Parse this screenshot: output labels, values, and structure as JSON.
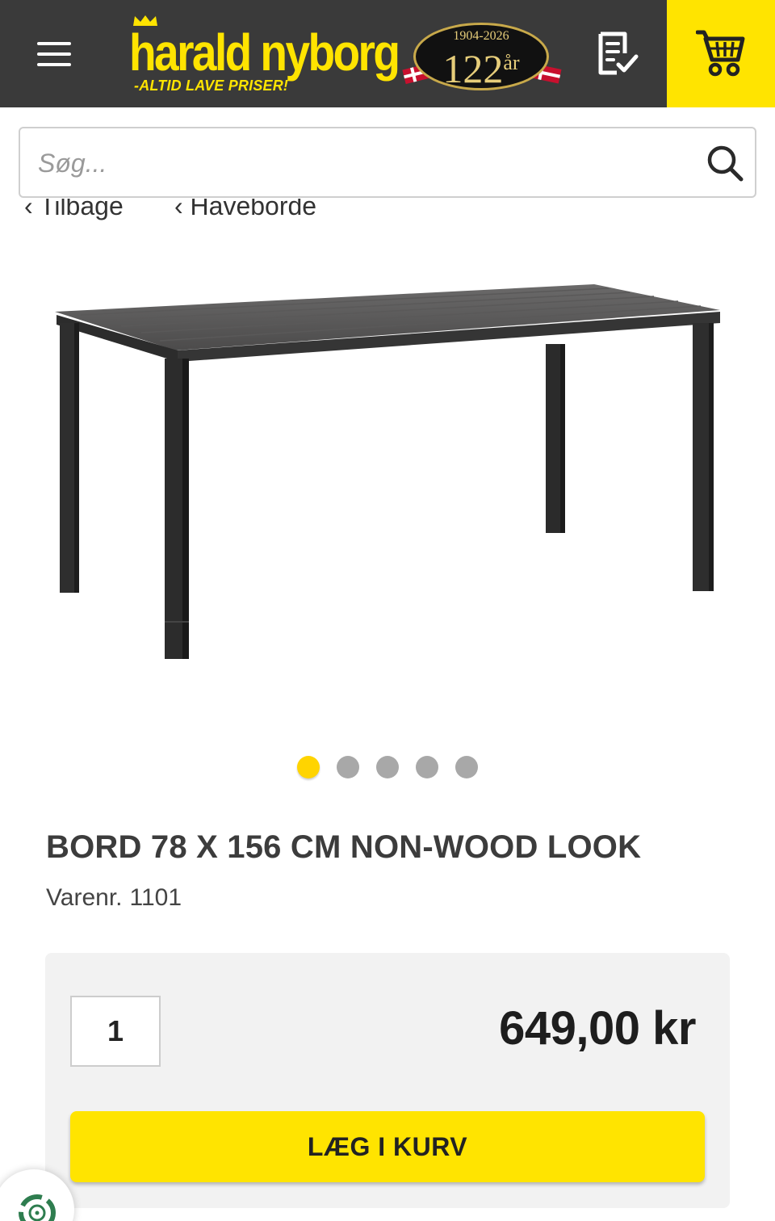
{
  "header": {
    "logo_name": "harald nyborg",
    "logo_tagline": "-ALTID LAVE PRISER!",
    "anniversary_years": "1904-2026",
    "anniversary_number": "122",
    "anniversary_unit": "år"
  },
  "search": {
    "placeholder": "Søg..."
  },
  "breadcrumb": {
    "back_label": "‹  Tilbage",
    "category_label": "‹  Haveborde"
  },
  "gallery": {
    "image_count": 5,
    "active_index": 0
  },
  "product": {
    "title": "BORD 78 X 156 CM NON-WOOD LOOK",
    "sku_label": "Varenr.",
    "sku_value": "1101",
    "quantity": "1",
    "price": "649,00 kr",
    "add_to_cart_label": "LÆG I KURV"
  },
  "colors": {
    "header_bg": "#3a3a3a",
    "brand_yellow": "#ffe400",
    "buybox_bg": "#f2f2f2"
  },
  "icons": {
    "menu": "hamburger-menu-icon",
    "list": "shopping-list-icon",
    "cart": "cart-icon",
    "search": "search-icon",
    "widget": "recycle-badge-icon"
  }
}
